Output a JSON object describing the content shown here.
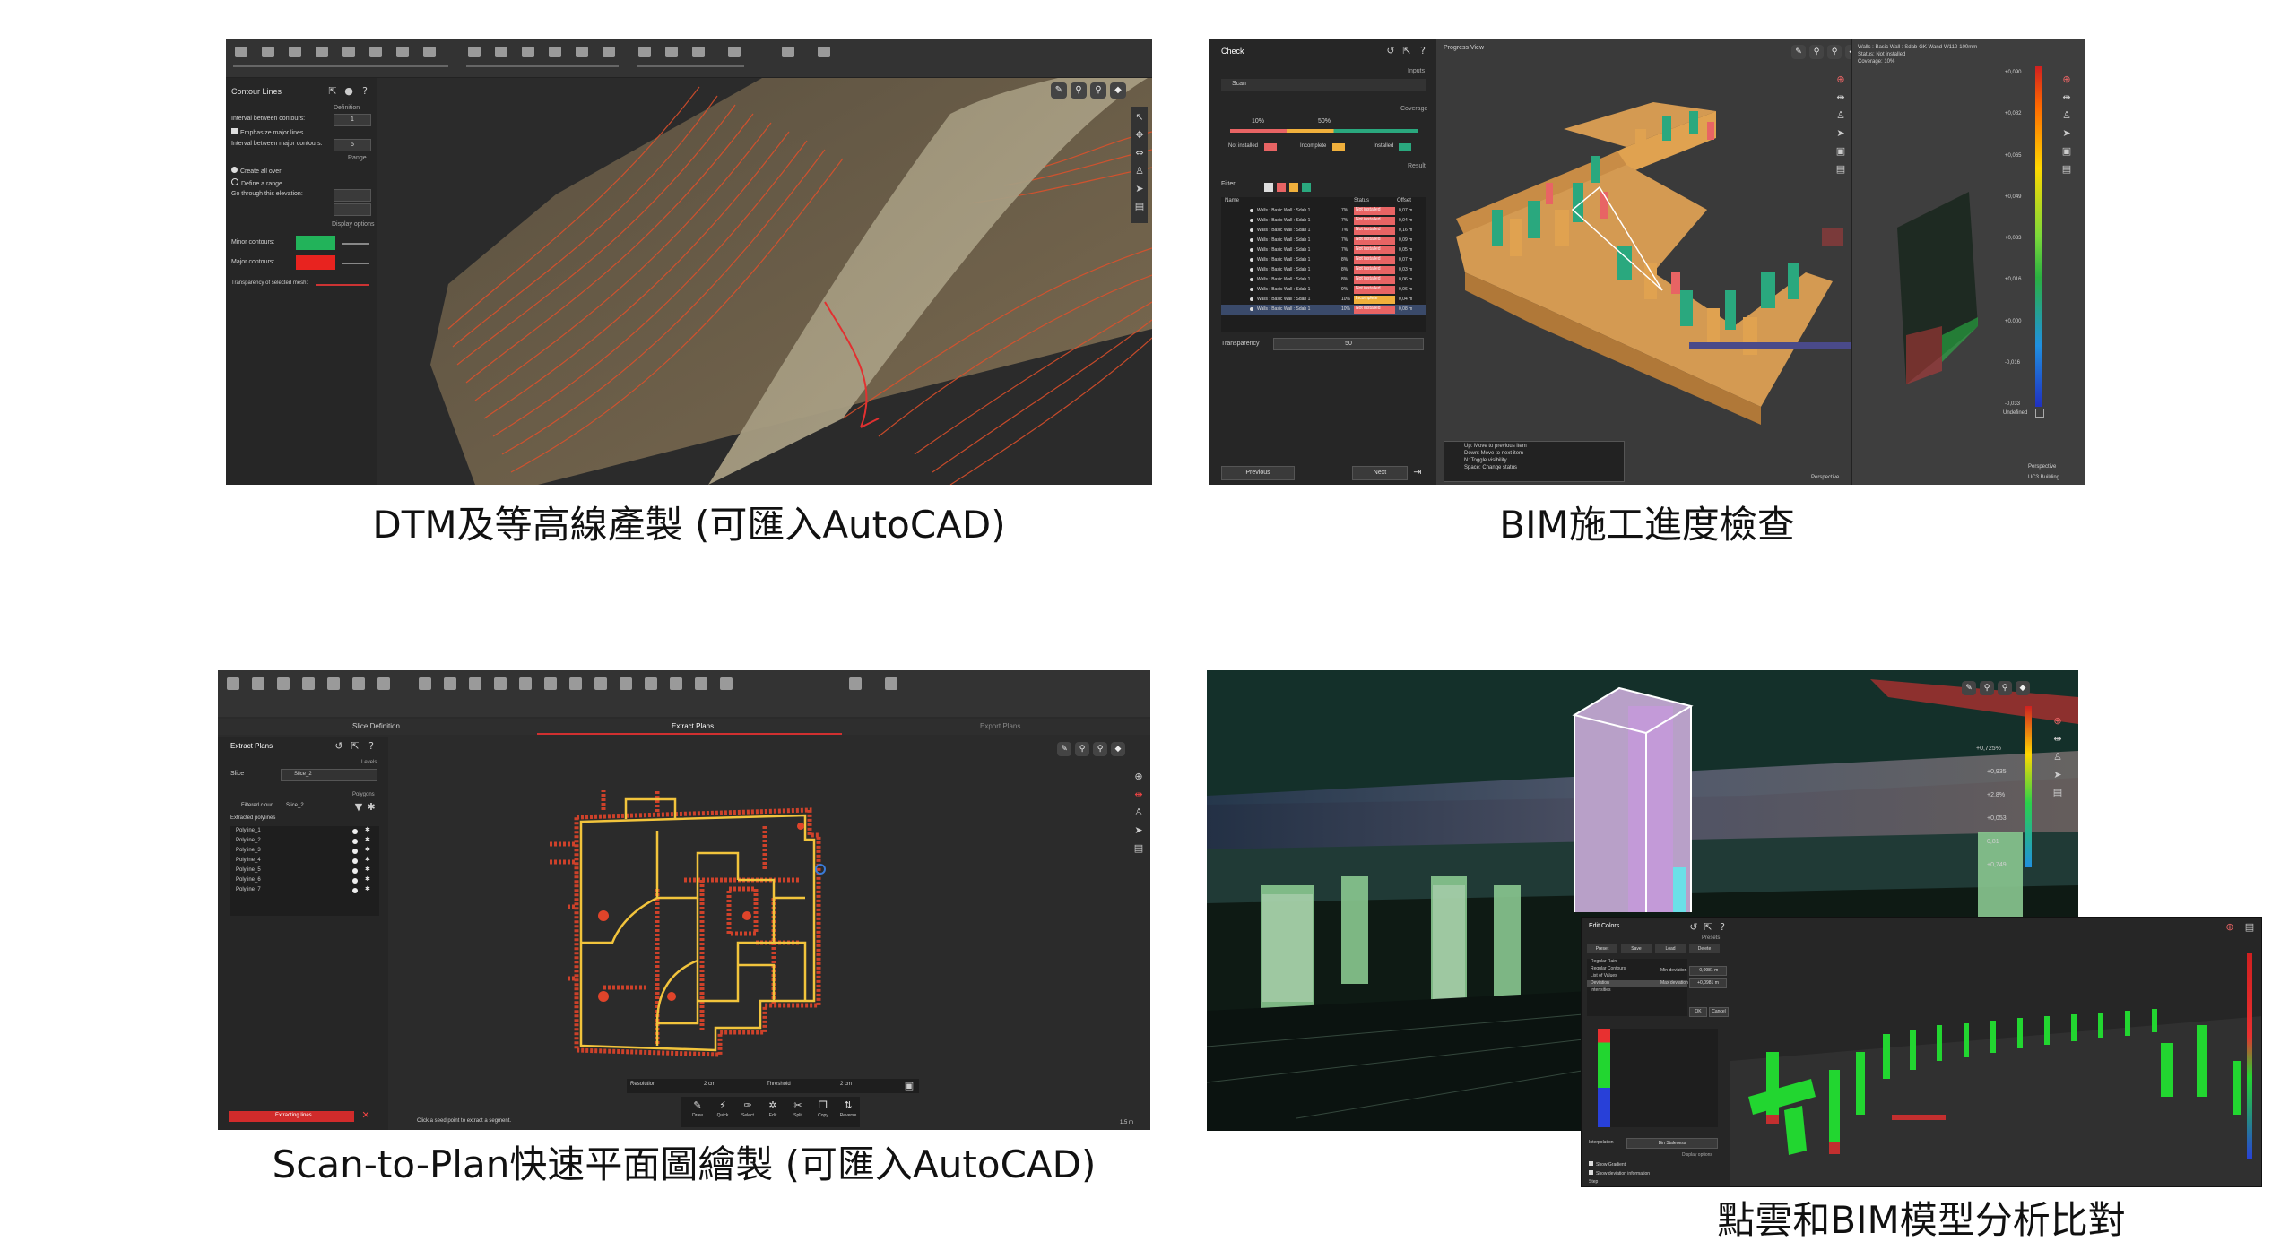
{
  "captions": {
    "top_left": "DTM及等高線產製 (可匯入AutoCAD)",
    "top_right": "BIM施工進度檢查",
    "bottom_left": "Scan-to-Plan快速平面圖繪製 (可匯入AutoCAD)",
    "bottom_right": "點雲和BIM模型分析比對"
  },
  "dtm": {
    "panel_title": "Contour Lines",
    "section_definition": "Definition",
    "interval_contours": "Interval between contours:",
    "interval_contours_value": "1",
    "emphasize_major": "Emphasize major lines",
    "interval_major": "Interval between major contours:",
    "interval_major_value": "5",
    "section_range": "Range",
    "create_all": "Create all over",
    "define_range": "Define a range",
    "go_through": "Go through this elevation:",
    "section_display": "Display options",
    "minor_contours": "Minor contours:",
    "major_contours": "Major contours:",
    "transparency": "Transparency of selected mesh:",
    "colors": {
      "minor": "#22b35a",
      "major": "#e8231f",
      "contour": "#e2502a",
      "terrain": "#7a6e52"
    }
  },
  "bim": {
    "panel_title": "Check",
    "section_inputs": "Inputs",
    "scan_label": "Scan",
    "section_coverage": "Coverage",
    "coverage_low": "10%",
    "coverage_high": "50%",
    "legend_not_installed": "Not installed",
    "legend_incomplete": "Incomplete",
    "legend_installed": "Installed",
    "section_result": "Result",
    "filter_label": "Filter",
    "table_headers": [
      "Name",
      "Status",
      "Offset"
    ],
    "rows": [
      {
        "name": "Walls : Basic Wall : Sdab 1",
        "pct": "7%",
        "status": "Not installed",
        "offset": "0,07 m"
      },
      {
        "name": "Walls : Basic Wall : Sdab 1",
        "pct": "7%",
        "status": "Not installed",
        "offset": "0,04 m"
      },
      {
        "name": "Walls : Basic Wall : Sdab 1",
        "pct": "7%",
        "status": "Not installed",
        "offset": "0,16 m"
      },
      {
        "name": "Walls : Basic Wall : Sdab 1",
        "pct": "7%",
        "status": "Not installed",
        "offset": "0,09 m"
      },
      {
        "name": "Walls : Basic Wall : Sdab 1",
        "pct": "7%",
        "status": "Not installed",
        "offset": "0,05 m"
      },
      {
        "name": "Walls : Basic Wall : Sdab 1",
        "pct": "8%",
        "status": "Not installed",
        "offset": "0,07 m"
      },
      {
        "name": "Walls : Basic Wall : Sdab 1",
        "pct": "8%",
        "status": "Not installed",
        "offset": "0,03 m"
      },
      {
        "name": "Walls : Basic Wall : Sdab 1",
        "pct": "8%",
        "status": "Not installed",
        "offset": "0,06 m"
      },
      {
        "name": "Walls : Basic Wall : Sdab 1",
        "pct": "9%",
        "status": "Not installed",
        "offset": "0,06 m"
      },
      {
        "name": "Walls : Basic Wall : Sdab 1",
        "pct": "10%",
        "status": "Incomplete",
        "offset": "0,04 m"
      },
      {
        "name": "Walls : Basic Wall : Sdab 1",
        "pct": "10%",
        "status": "Not installed",
        "offset": "0,08 m"
      }
    ],
    "transparency_label": "Transparency",
    "transparency_value": "50",
    "previous_label": "Previous",
    "next_label": "Next",
    "view_title": "Progress View",
    "shortcuts": [
      "Up: Move to previous item",
      "Down: Move to next item",
      "N: Toggle visibility",
      "Space: Change status"
    ],
    "perspective_label": "Perspective",
    "detail_title": "Walls : Basic Wall : Sdab-GK Wand-W112-100mm",
    "detail_status": "Status: Not installed",
    "detail_coverage": "Coverage: 10%",
    "scale_values": [
      "+0,090",
      "+0,082",
      "+0,065",
      "+0,049",
      "+0,033",
      "+0,016",
      "+0,000",
      "-0,016",
      "-0,033"
    ],
    "undefined_label": "Undefined",
    "perspective_label_2": "Perspective",
    "building_label": "UC3 Building",
    "colors": {
      "not_installed": "#e86464",
      "incomplete": "#f0b03c",
      "installed": "#2aa87e",
      "wall": "#e0a250",
      "floor": "#d49a52"
    }
  },
  "plan": {
    "tab_slice": "Slice Definition",
    "tab_extract": "Extract Plans",
    "tab_export": "Export Plans",
    "panel_title": "Extract Plans",
    "section_levels": "Levels",
    "slice_label": "Slice",
    "slice_value": "Slice_2",
    "section_polygons": "Polygons",
    "filtered_cloud": "Filtered cloud",
    "filtered_cloud_value": "Slice_2",
    "extracted_polylines": "Extracted polylines",
    "polylines": [
      "Polyline_1",
      "Polyline_2",
      "Polyline_3",
      "Polyline_4",
      "Polyline_5",
      "Polyline_6",
      "Polyline_7"
    ],
    "extracting_label": "Extracting lines...",
    "status_hint": "Click a seed point to extract a segment.",
    "resolution_label": "Resolution",
    "resolution_value": "2 cm",
    "threshold_label": "Threshold",
    "threshold_value": "2 cm",
    "tools": [
      "Draw",
      "Quick",
      "Select",
      "Edit",
      "Split",
      "Copy",
      "Reverse"
    ],
    "scale_text": "1.5 m",
    "colors": {
      "cloud": "#e0442a",
      "lines": "#f2c43c"
    }
  },
  "compare": {
    "dialog_title": "Edit Colors",
    "section_presets": "Presets",
    "preset_tabs": [
      "Preset",
      "Save",
      "Load",
      "Delete"
    ],
    "list_items": [
      "Regular Rain",
      "Regular Contours",
      "List of Values",
      "Deviation",
      "Intensities"
    ],
    "min_label": "Min deviation",
    "min_value": "-0,0981 m",
    "max_label": "Max deviation",
    "max_value": "+0,0981 m",
    "ok_label": "OK",
    "cancel_label": "Cancel",
    "interpolation_label": "Interpolation",
    "interpolation_value": "Bin Staleness",
    "display_options": "Display options",
    "show_gradient": "Show Gradient",
    "show_deviation": "Show deviation information",
    "slice_label": "Step",
    "scale_top": "+0,725%",
    "scale_values": [
      "+0,935",
      "+2,8%",
      "+0,053",
      "0,81",
      "+0,749"
    ],
    "colors": {
      "column": "#c39ad8",
      "green": "#22d630",
      "red": "#e83030",
      "blue": "#2840d8"
    }
  }
}
